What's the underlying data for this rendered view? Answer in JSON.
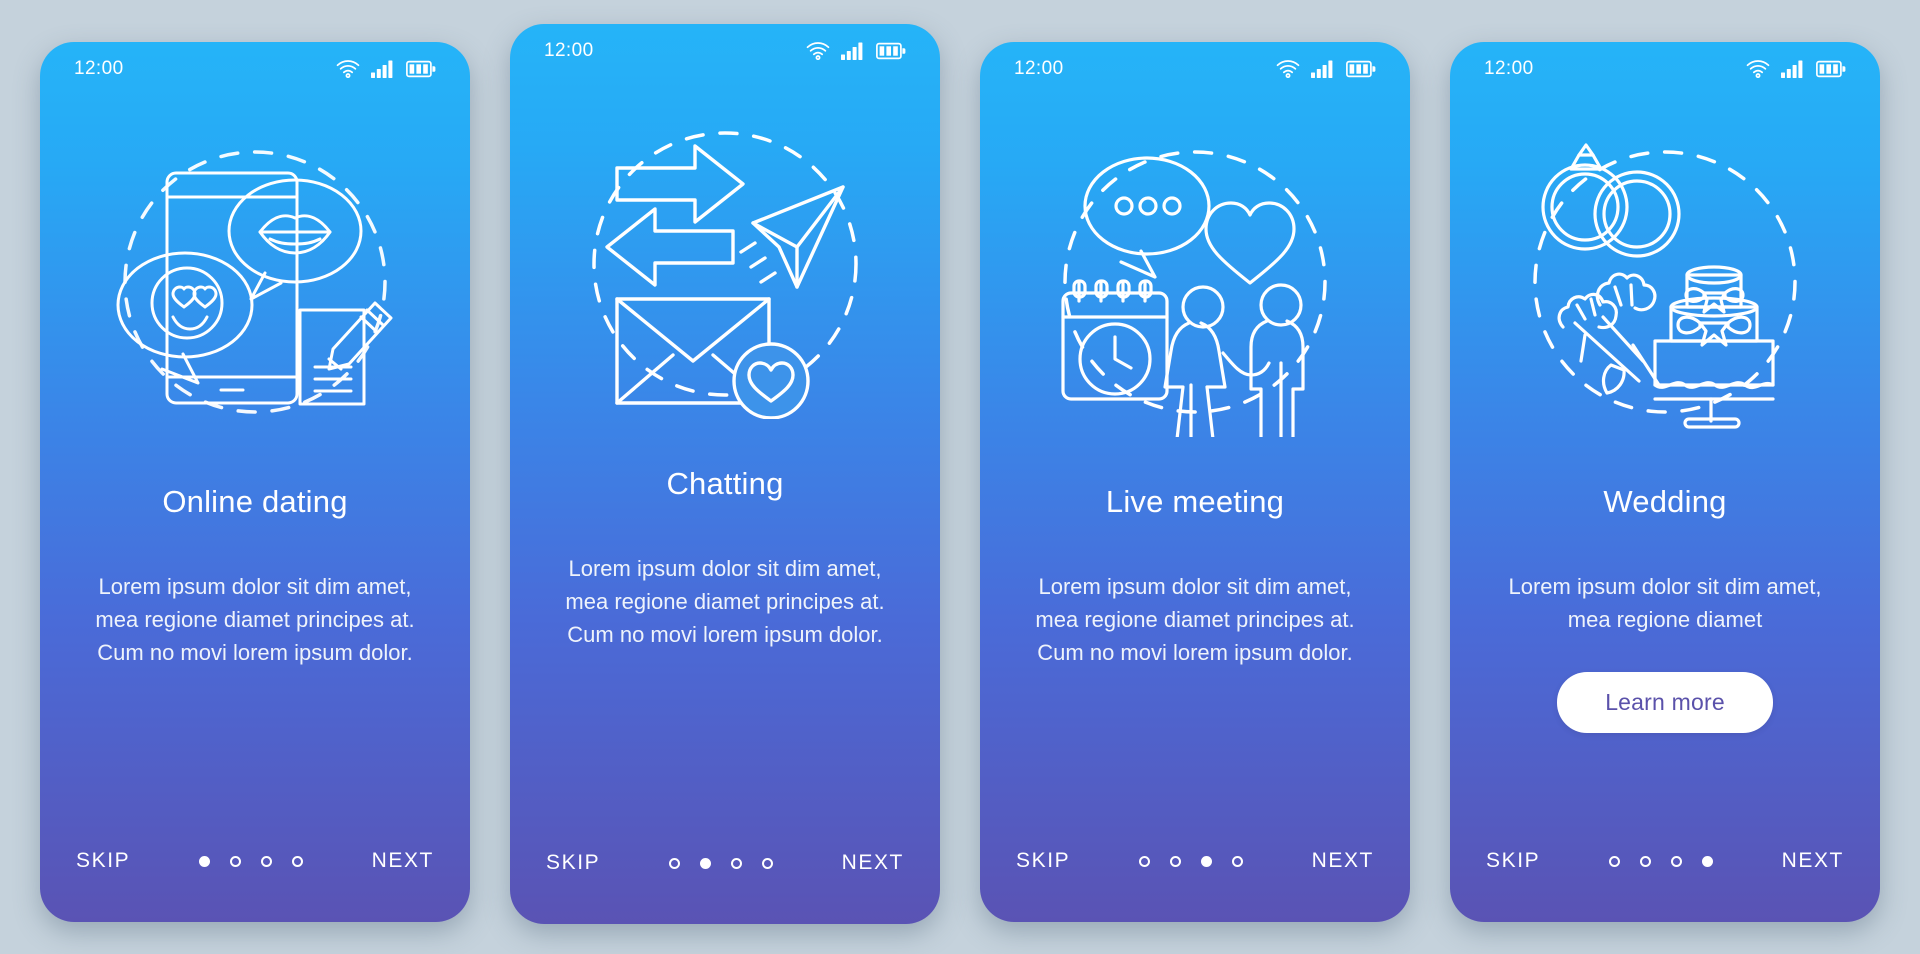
{
  "theme": {
    "page_background": "#c5d2dc",
    "gradient_top": "#25b4f8",
    "gradient_bottom": "#5a53b4",
    "accent_text": "#ffffff",
    "cta_text_color": "#5a51aa",
    "cta_background": "#ffffff"
  },
  "screens": [
    {
      "status": {
        "time": "12:00",
        "wifi_icon": "wifi-icon",
        "signal_icon": "signal-bars-icon",
        "battery_icon": "battery-icon"
      },
      "illustration": {
        "name": "online-dating-illustration",
        "elements": [
          "smartphone",
          "speech-bubble-lips",
          "speech-bubble-smiley-heart-eyes",
          "note-with-pencil",
          "dashed-circle"
        ]
      },
      "title": "Online dating",
      "body": "Lorem ipsum dolor sit dim amet, mea regione diamet principes at. Cum no movi lorem ipsum dolor.",
      "cta": null,
      "skip_label": "SKIP",
      "next_label": "NEXT",
      "dots": {
        "count": 4,
        "active_index": 0
      }
    },
    {
      "status": {
        "time": "12:00",
        "wifi_icon": "wifi-icon",
        "signal_icon": "signal-bars-icon",
        "battery_icon": "battery-icon"
      },
      "illustration": {
        "name": "chatting-illustration",
        "elements": [
          "exchange-arrows",
          "paper-plane",
          "envelope",
          "heart-badge",
          "dashed-circle"
        ]
      },
      "title": "Chatting",
      "body": "Lorem ipsum dolor sit dim amet, mea regione diamet principes at. Cum no movi lorem ipsum dolor.",
      "cta": null,
      "skip_label": "SKIP",
      "next_label": "NEXT",
      "dots": {
        "count": 4,
        "active_index": 1
      }
    },
    {
      "status": {
        "time": "12:00",
        "wifi_icon": "wifi-icon",
        "signal_icon": "signal-bars-icon",
        "battery_icon": "battery-icon"
      },
      "illustration": {
        "name": "live-meeting-illustration",
        "elements": [
          "speech-bubble-dots",
          "heart",
          "calendar-with-clock",
          "couple-holding-hands",
          "dashed-circle"
        ]
      },
      "title": "Live meeting",
      "body": "Lorem ipsum dolor sit dim amet, mea regione diamet principes at. Cum no movi lorem ipsum dolor.",
      "cta": null,
      "skip_label": "SKIP",
      "next_label": "NEXT",
      "dots": {
        "count": 4,
        "active_index": 2
      }
    },
    {
      "status": {
        "time": "12:00",
        "wifi_icon": "wifi-icon",
        "signal_icon": "signal-bars-icon",
        "battery_icon": "battery-icon"
      },
      "illustration": {
        "name": "wedding-illustration",
        "elements": [
          "wedding-rings",
          "tulip-bouquet",
          "tiered-wedding-cake",
          "dashed-circle"
        ]
      },
      "title": "Wedding",
      "body": "Lorem ipsum dolor sit dim amet, mea regione diamet",
      "cta": "Learn more",
      "skip_label": "SKIP",
      "next_label": "NEXT",
      "dots": {
        "count": 4,
        "active_index": 3
      }
    }
  ]
}
